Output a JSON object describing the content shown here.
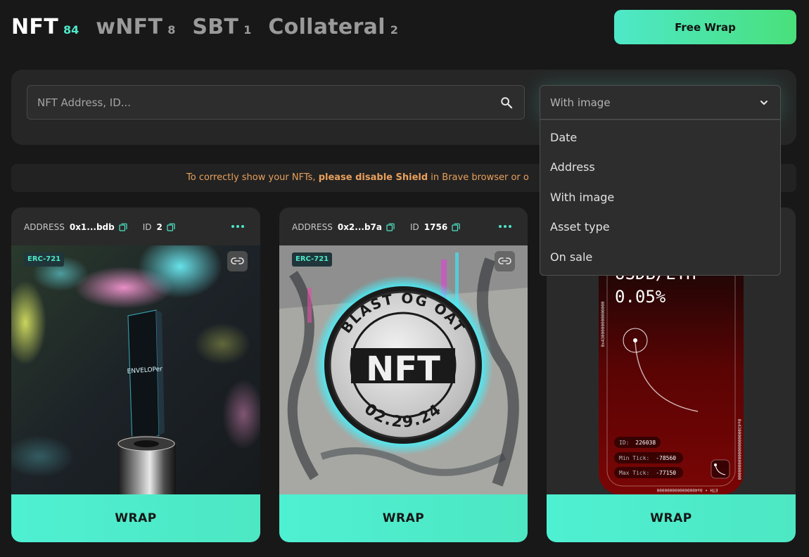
{
  "tabs": [
    {
      "label": "NFT",
      "count": "84"
    },
    {
      "label": "wNFT",
      "count": "8"
    },
    {
      "label": "SBT",
      "count": "1"
    },
    {
      "label": "Collateral",
      "count": "2"
    }
  ],
  "free_wrap_label": "Free Wrap",
  "search": {
    "placeholder": "NFT Address, ID..."
  },
  "filter": {
    "selected": "With image",
    "options": [
      "Date",
      "Address",
      "With image",
      "Asset type",
      "On sale"
    ]
  },
  "notice": {
    "prefix": "To correctly show your NFTs,",
    "bold": "please disable Shield",
    "suffix": "in  Brave browser or  o"
  },
  "cards": [
    {
      "address_label": "ADDRESS",
      "address": "0x1...bdb",
      "id_label": "ID",
      "id": "2",
      "badge": "ERC-721",
      "image_text": "ENVELOPer",
      "wrap_label": "WRAP"
    },
    {
      "address_label": "ADDRESS",
      "address": "0x2...b7a",
      "id_label": "ID",
      "id": "1756",
      "badge": "ERC-721",
      "image_text_top": "BLAST OG OAT",
      "image_text_mid": "NFT",
      "image_text_bottom": "02.29.24",
      "wrap_label": "WRAP"
    },
    {
      "wrap_label": "WRAP",
      "pair": "USDB/ETH",
      "fee": "0.05%",
      "token_label": "ID:",
      "token_id": "226038",
      "min_tick_label": "Min Tick:",
      "min_tick": "-78560",
      "max_tick_label": "Max Tick:",
      "max_tick": "-77150",
      "side_text_left": "0x4300000000000000",
      "side_text_right": "0x4300000000000000000000",
      "bottom_text": "ETH • 0x4000000000000000"
    }
  ],
  "colors": {
    "accent": "#4ee8c9",
    "accent_green": "#49e07b",
    "notice": "#e8a05c",
    "background": "#181818",
    "panel": "#262626"
  },
  "icons": {
    "search": "search-icon",
    "chevron": "chevron-down-icon",
    "copy": "copy-icon",
    "more": "more-icon",
    "link": "link-icon"
  }
}
